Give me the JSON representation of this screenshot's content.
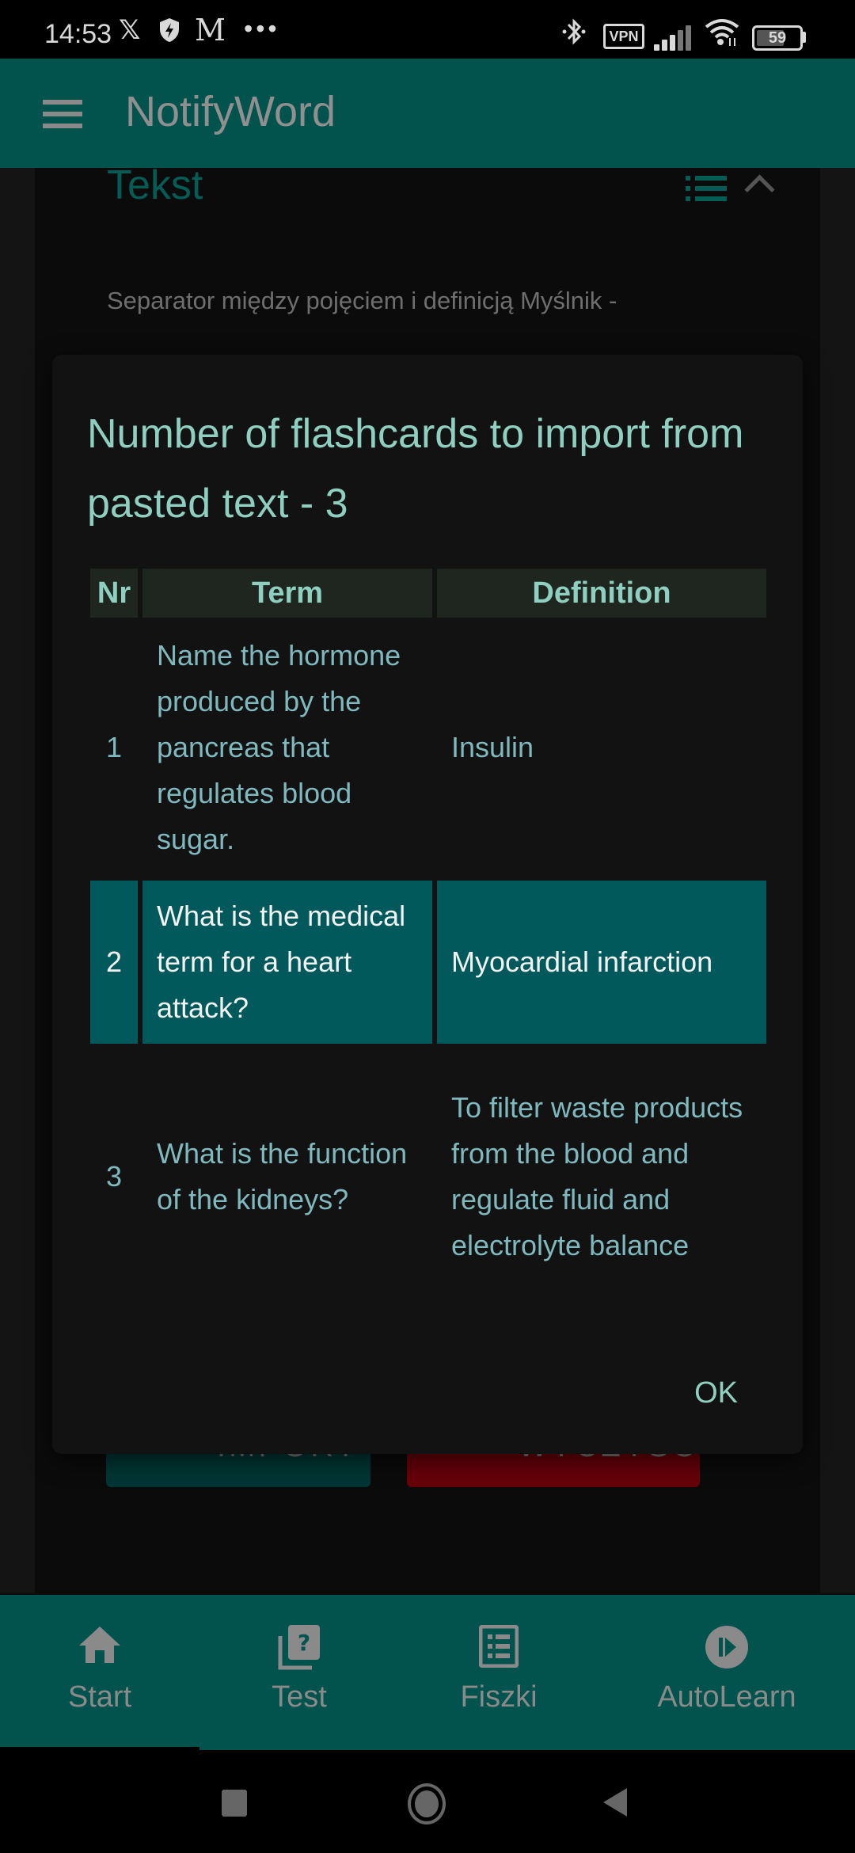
{
  "status_bar": {
    "time": "14:53",
    "left_icons": [
      "x-app-icon",
      "shield-bolt-icon",
      "m-app-icon",
      "more-dots-icon"
    ],
    "right_icons": [
      "bluetooth-icon",
      "vpn-icon",
      "signal-icon",
      "wifi-icon",
      "battery-icon"
    ],
    "vpn_label": "VPN",
    "battery_level": "59",
    "battery_percent": 59
  },
  "app_bar": {
    "title": "NotifyWord",
    "menu_icon": "hamburger-menu-icon"
  },
  "background_page": {
    "section_title": "Tekst",
    "separator_text": "Separator między pojęciem i definicją Myślnik -",
    "import_button": "IMPORT",
    "clear_button": "WYCZYŚĆ"
  },
  "dialog": {
    "title": "Number of flashcards to import from pasted text - 3",
    "columns": [
      "Nr",
      "Term",
      "Definition"
    ],
    "rows": [
      {
        "nr": "1",
        "term": "Name the hormone produced by the pancreas that regulates blood sugar.",
        "definition": "Insulin",
        "selected": false
      },
      {
        "nr": "2",
        "term": "What is the medical term for a heart attack?",
        "definition": "Myocardial infarction",
        "selected": true
      },
      {
        "nr": "3",
        "term": "What is the function of the kidneys?",
        "definition": "To filter waste products from the blood and regulate fluid and electrolyte balance",
        "selected": false
      }
    ],
    "ok_label": "OK"
  },
  "bottom_nav": {
    "items": [
      {
        "label": "Start",
        "icon": "home-icon",
        "active": true
      },
      {
        "label": "Test",
        "icon": "quiz-icon",
        "active": false
      },
      {
        "label": "Fiszki",
        "icon": "list-card-icon",
        "active": false
      },
      {
        "label": "AutoLearn",
        "icon": "play-circle-icon",
        "active": false
      }
    ]
  },
  "colors": {
    "primary": "#02524d",
    "accent_text": "#8fcfbf",
    "selected_row": "#02595b",
    "danger": "#660009"
  }
}
